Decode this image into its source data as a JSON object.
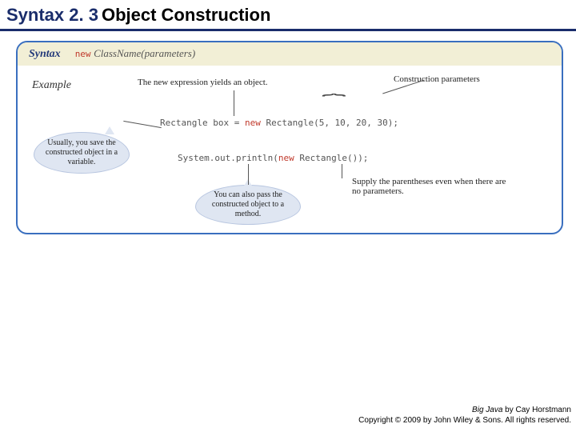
{
  "header": {
    "prefix": "Syntax 2. 3",
    "title": "Object Construction"
  },
  "syntax": {
    "label": "Syntax",
    "keyword": "new",
    "form": "ClassName(parameters)"
  },
  "example": {
    "label": "Example",
    "line1_a": "Rectangle box = ",
    "line1_kw": "new",
    "line1_b": " Rectangle(5, 10, 20, 30);",
    "line2_a": "System.out.println(",
    "line2_kw": "new",
    "line2_b": " Rectangle());"
  },
  "annotations": {
    "top": "The new expression yields an object.",
    "topright": "Construction parameters",
    "bottomright": "Supply the parentheses even when there are no parameters."
  },
  "callouts": {
    "left": "Usually, you save the constructed object in a variable.",
    "bottom": "You can also pass the constructed object to a method."
  },
  "footer": {
    "book": "Big Java",
    "byline": " by Cay Horstmann",
    "copyright": "Copyright © 2009 by John Wiley & Sons. All rights reserved."
  }
}
